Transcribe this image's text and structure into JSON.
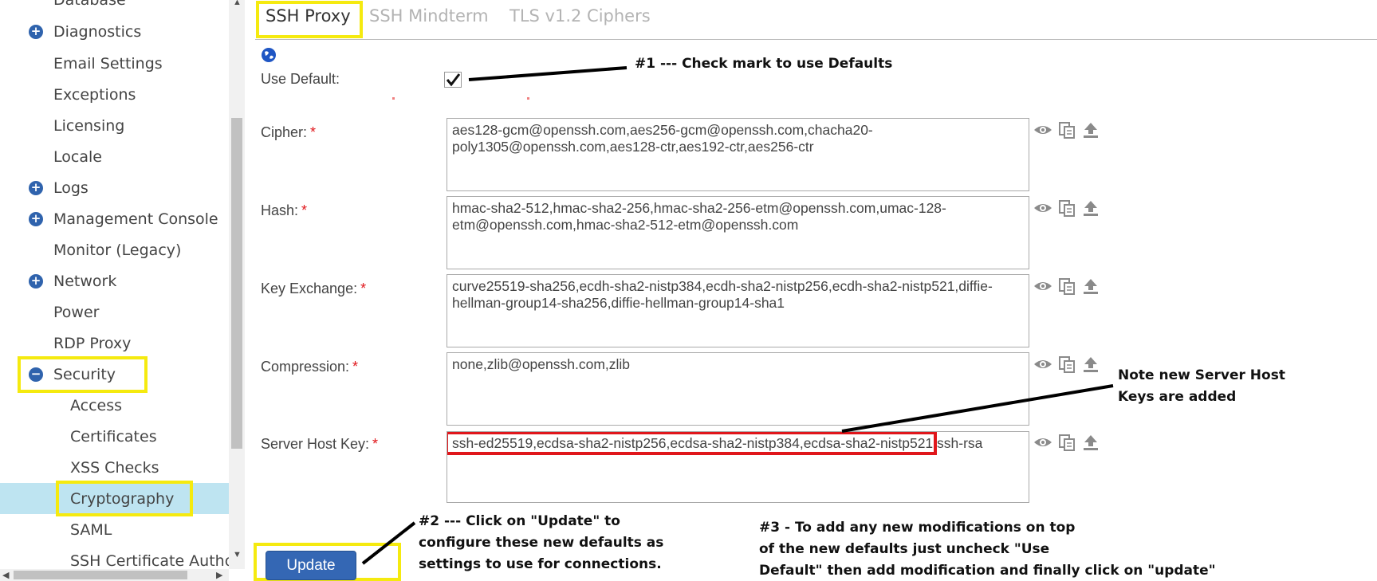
{
  "sidebar": {
    "items": [
      {
        "label": "Database",
        "expander": ""
      },
      {
        "label": "Diagnostics",
        "expander": "+"
      },
      {
        "label": "Email Settings",
        "expander": ""
      },
      {
        "label": "Exceptions",
        "expander": ""
      },
      {
        "label": "Licensing",
        "expander": ""
      },
      {
        "label": "Locale",
        "expander": ""
      },
      {
        "label": "Logs",
        "expander": "+"
      },
      {
        "label": "Management Console",
        "expander": "+"
      },
      {
        "label": "Monitor (Legacy)",
        "expander": ""
      },
      {
        "label": "Network",
        "expander": "+"
      },
      {
        "label": "Power",
        "expander": ""
      },
      {
        "label": "RDP Proxy",
        "expander": ""
      },
      {
        "label": "Security",
        "expander": "−"
      }
    ],
    "subitems": [
      {
        "label": "Access"
      },
      {
        "label": "Certificates"
      },
      {
        "label": "XSS Checks"
      },
      {
        "label": "Cryptography"
      },
      {
        "label": "SAML"
      },
      {
        "label": "SSH Certificate Authori"
      }
    ]
  },
  "tabs": [
    {
      "label": "SSH Proxy",
      "active": true
    },
    {
      "label": "SSH Mindterm",
      "active": false
    },
    {
      "label": "TLS v1.2 Ciphers",
      "active": false
    }
  ],
  "form": {
    "use_default": {
      "label": "Use Default:",
      "checked": true
    },
    "fields": [
      {
        "label": "Cipher:",
        "value": "aes128-gcm@openssh.com,aes256-gcm@openssh.com,chacha20-poly1305@openssh.com,aes128-ctr,aes192-ctr,aes256-ctr"
      },
      {
        "label": "Hash:",
        "value": "hmac-sha2-512,hmac-sha2-256,hmac-sha2-256-etm@openssh.com,umac-128-etm@openssh.com,hmac-sha2-512-etm@openssh.com"
      },
      {
        "label": "Key Exchange:",
        "value": "curve25519-sha256,ecdh-sha2-nistp384,ecdh-sha2-nistp256,ecdh-sha2-nistp521,diffie-hellman-group14-sha256,diffie-hellman-group14-sha1"
      },
      {
        "label": "Compression:",
        "value": "none,zlib@openssh.com,zlib"
      }
    ],
    "server_host_key": {
      "label": "Server Host Key:",
      "highlighted": "ssh-ed25519,ecdsa-sha2-nistp256,ecdsa-sha2-nistp384,ecdsa-sha2-nistp521",
      "rest": "ssh-rsa"
    },
    "required_marker": "*",
    "update_label": "Update"
  },
  "annotations": {
    "note1": "#1 --- Check mark to use Defaults",
    "note2": [
      "#2 --- Click on \"Update\" to",
      "configure these new defaults as",
      "settings to use for connections."
    ],
    "note3": [
      "#3 - To add any new modifications on top",
      "of the new defaults just uncheck \"Use",
      "Default\" then add modification and finally  click on \"update\""
    ],
    "note4": [
      "Note new Server Host",
      "Keys are added"
    ]
  },
  "icons": {
    "expander": "plus-circle-icon",
    "collapse": "minus-circle-icon",
    "help": "globe-help-icon",
    "view": "eye-icon",
    "copy": "copy-icon",
    "upload": "upload-icon"
  },
  "colors": {
    "highlight_yellow": "#f5ea0f",
    "highlight_red": "#e0161b",
    "selected_row": "#bee4f1",
    "button_blue": "#3467b4"
  }
}
